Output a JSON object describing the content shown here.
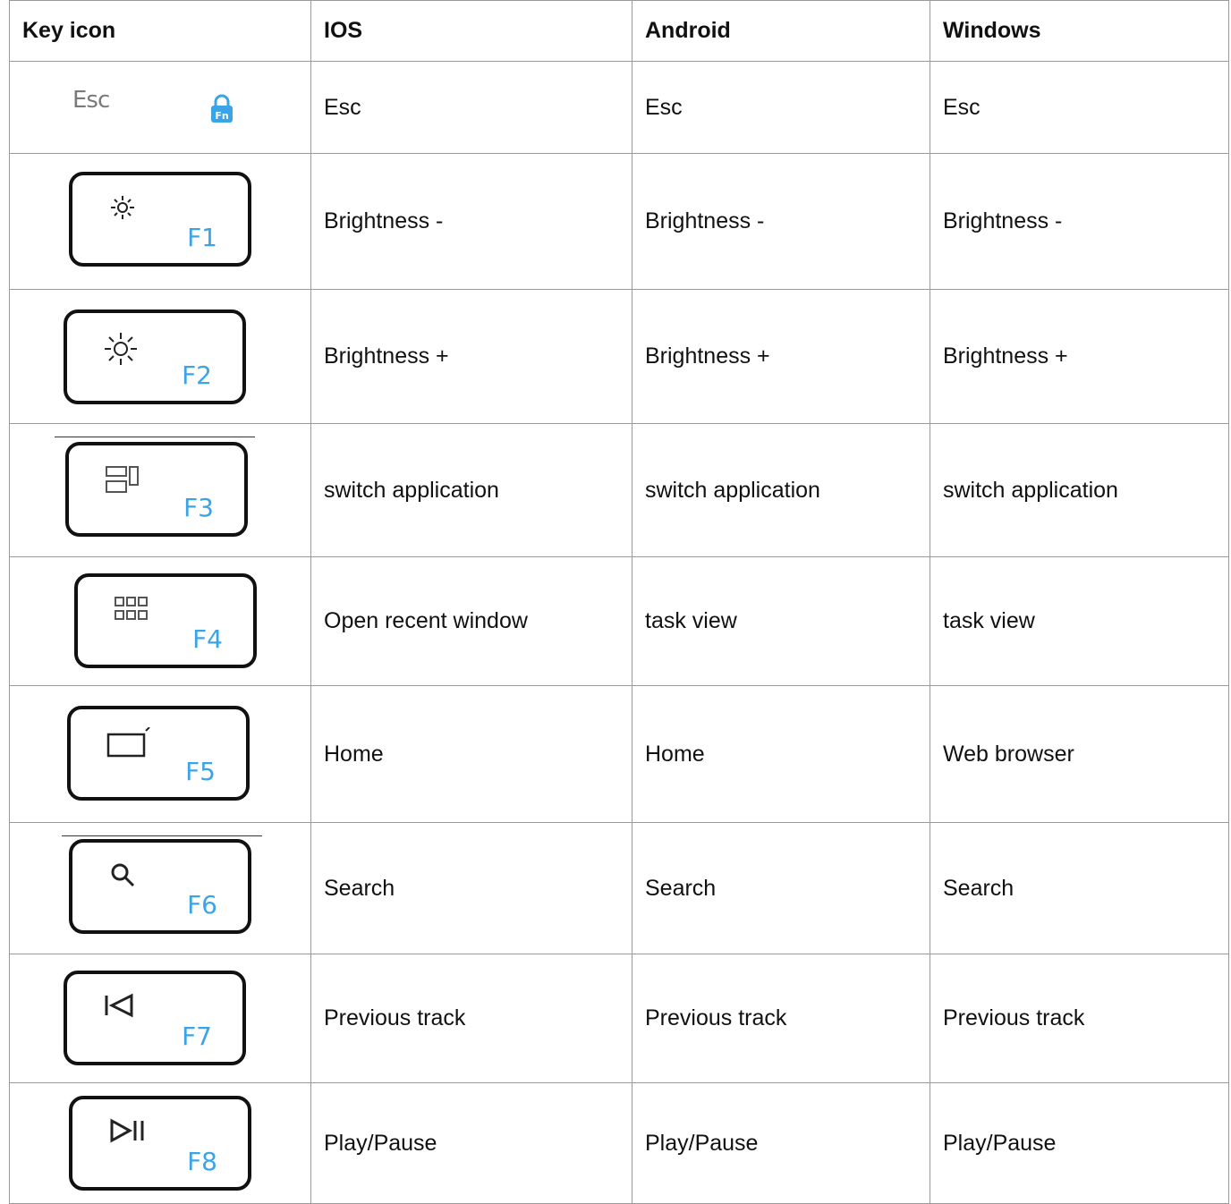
{
  "headers": [
    "Key icon",
    "IOS",
    "Android",
    "Windows"
  ],
  "esc_key": {
    "label": "Esc",
    "icon": "fn-lock-icon",
    "color": "#3aa4e6"
  },
  "rows": [
    {
      "icon": "esc",
      "fkey": "",
      "ios": "Esc",
      "android": "Esc",
      "windows": "Esc"
    },
    {
      "icon": "brightness-down",
      "fkey": "F1",
      "ios": "Brightness -",
      "android": "Brightness -",
      "windows": "Brightness -"
    },
    {
      "icon": "brightness-up",
      "fkey": "F2",
      "ios": "Brightness +",
      "android": "Brightness +",
      "windows": "Brightness +"
    },
    {
      "icon": "switch-app",
      "fkey": "F3",
      "ios": "switch application",
      "android": "switch application",
      "windows": "switch application"
    },
    {
      "icon": "task-grid",
      "fkey": "F4",
      "ios": "Open recent window",
      "android": "task view",
      "windows": "task view"
    },
    {
      "icon": "home-window",
      "fkey": "F5",
      "ios": "Home",
      "android": "Home",
      "windows": "Web browser"
    },
    {
      "icon": "search",
      "fkey": "F6",
      "ios": "Search",
      "android": "Search",
      "windows": "Search"
    },
    {
      "icon": "previous-track",
      "fkey": "F7",
      "ios": "Previous track",
      "android": "Previous track",
      "windows": "Previous track"
    },
    {
      "icon": "play-pause",
      "fkey": "F8",
      "ios": "Play/Pause",
      "android": "Play/Pause",
      "windows": "Play/Pause"
    }
  ],
  "fkey_color": "#3aa4e6"
}
